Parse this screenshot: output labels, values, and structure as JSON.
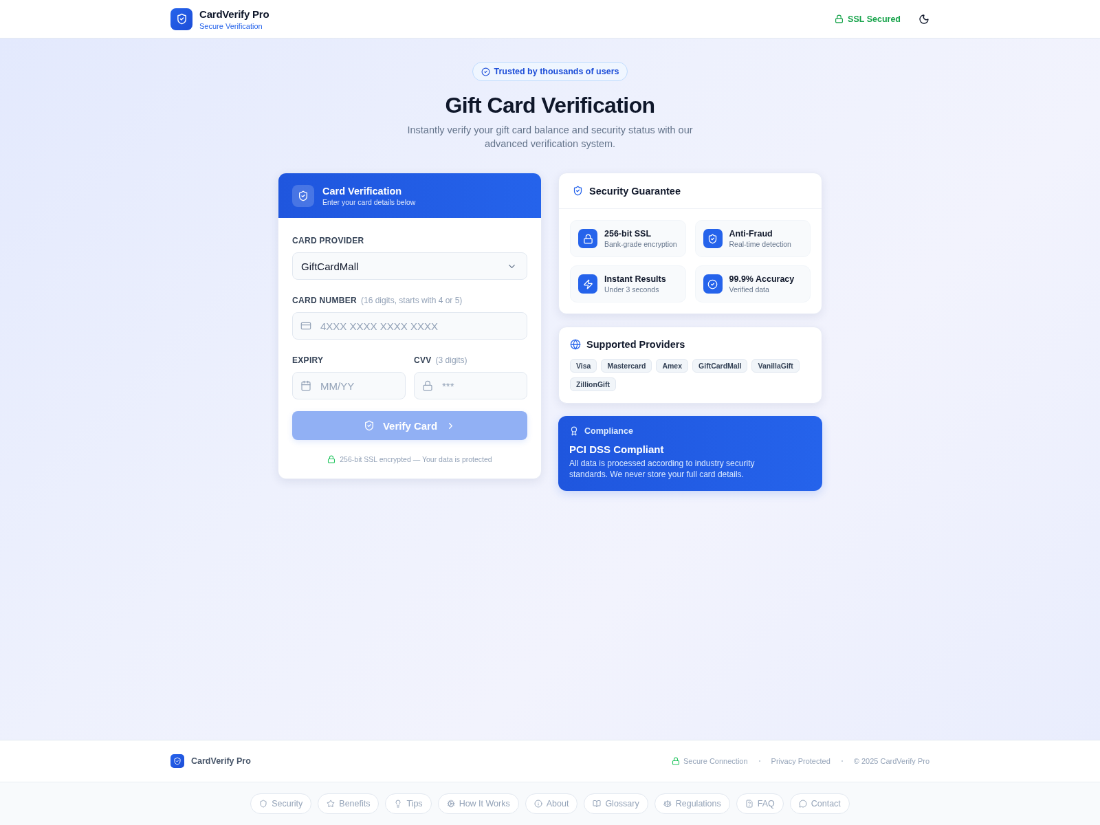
{
  "header": {
    "brand": "CardVerify Pro",
    "tagline": "Secure Verification",
    "ssl_status": "SSL Secured"
  },
  "hero": {
    "badge": "Trusted by thousands of users",
    "title": "Gift Card Verification",
    "subtitle": "Instantly verify your gift card balance and security status with our advanced verification system."
  },
  "verification_card": {
    "title": "Card Verification",
    "subtitle": "Enter your card details below",
    "provider": {
      "label": "CARD PROVIDER",
      "value": "GiftCardMall"
    },
    "card_number": {
      "label": "CARD NUMBER",
      "hint": "(16 digits, starts with 4 or 5)",
      "placeholder": "4XXX XXXX XXXX XXXX"
    },
    "expiry": {
      "label": "EXPIRY",
      "placeholder": "MM/YY"
    },
    "cvv": {
      "label": "CVV",
      "hint": "(3 digits)",
      "placeholder": "***"
    },
    "verify_button": {
      "label": "Verify Card",
      "disabled": true
    },
    "security_note": "256-bit SSL encrypted — Your data is protected"
  },
  "security_guarantee": {
    "title": "Security Guarantee",
    "features": [
      {
        "title": "256-bit SSL",
        "subtitle": "Bank-grade encryption"
      },
      {
        "title": "Anti-Fraud",
        "subtitle": "Real-time detection"
      },
      {
        "title": "Instant Results",
        "subtitle": "Under 3 seconds"
      },
      {
        "title": "99.9% Accuracy",
        "subtitle": "Verified data"
      }
    ]
  },
  "supported_providers": {
    "title": "Supported Providers",
    "providers": [
      "Visa",
      "Mastercard",
      "Amex",
      "GiftCardMall",
      "VanillaGift",
      "ZillionGift"
    ]
  },
  "compliance": {
    "label": "Compliance",
    "title": "PCI DSS Compliant",
    "text": "All data is processed according to industry security standards. We never store your full card details."
  },
  "footer": {
    "brand": "CardVerify Pro",
    "items": [
      "Secure Connection",
      "Privacy Protected",
      "© 2025 CardVerify Pro"
    ]
  },
  "footer_nav": [
    "Security",
    "Benefits",
    "Tips",
    "How It Works",
    "About",
    "Glossary",
    "Regulations",
    "FAQ",
    "Contact"
  ]
}
